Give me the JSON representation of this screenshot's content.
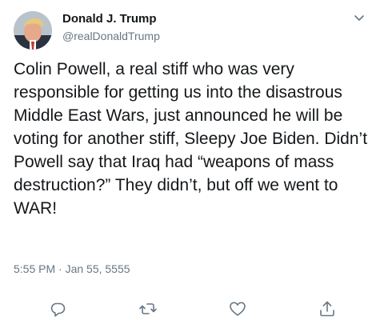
{
  "author": {
    "display_name": "Donald J. Trump",
    "handle": "@realDonaldTrump"
  },
  "tweet": {
    "text": "Colin Powell, a real stiff who was very responsible for getting us into the disastrous Middle East Wars, just announced he will be voting for another stiff, Sleepy Joe Biden. Didn’t Powell say that Iraq had “weapons of mass destruction?” They didn’t, but off we went to WAR!",
    "timestamp": "5:55 PM · Jan 55, 5555"
  },
  "icons": {
    "menu": "chevron-down-icon",
    "reply": "reply-icon",
    "retweet": "retweet-icon",
    "like": "heart-icon",
    "share": "share-icon"
  },
  "colors": {
    "text": "#14171a",
    "secondary": "#657786",
    "icon": "#657786"
  }
}
